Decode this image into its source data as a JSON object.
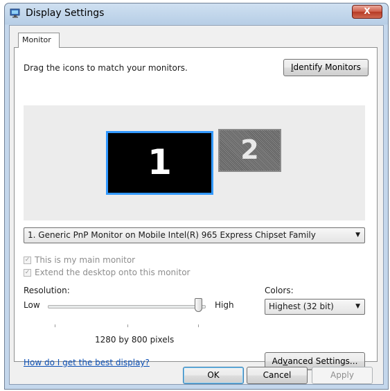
{
  "window": {
    "title": "Display Settings",
    "close_label": "X"
  },
  "tabs": [
    {
      "label": "Monitor"
    }
  ],
  "monitor_panel": {
    "instruction": "Drag the icons to match your monitors.",
    "identify_button": "Identify Monitors",
    "monitors": [
      {
        "number": "1"
      },
      {
        "number": "2"
      }
    ],
    "monitor_select": "1. Generic PnP Monitor on Mobile Intel(R) 965 Express Chipset Family",
    "main_monitor_checkbox": {
      "label": "This is my main monitor",
      "checked": true
    },
    "extend_desktop_checkbox": {
      "label": "Extend the desktop onto this monitor",
      "checked": true
    },
    "resolution": {
      "label": "Resolution:",
      "low_label": "Low",
      "high_label": "High",
      "value_text": "1280 by 800 pixels",
      "slider_level": 1.0
    },
    "colors": {
      "label": "Colors:",
      "selected": "Highest (32 bit)"
    },
    "help_link": "How do I get the best display?",
    "advanced_button": "Advanced Settings..."
  },
  "footer": {
    "ok": "OK",
    "cancel": "Cancel",
    "apply": "Apply"
  },
  "colors_theme": {
    "selection_border": "#3399ff",
    "link": "#0b4fb5"
  }
}
